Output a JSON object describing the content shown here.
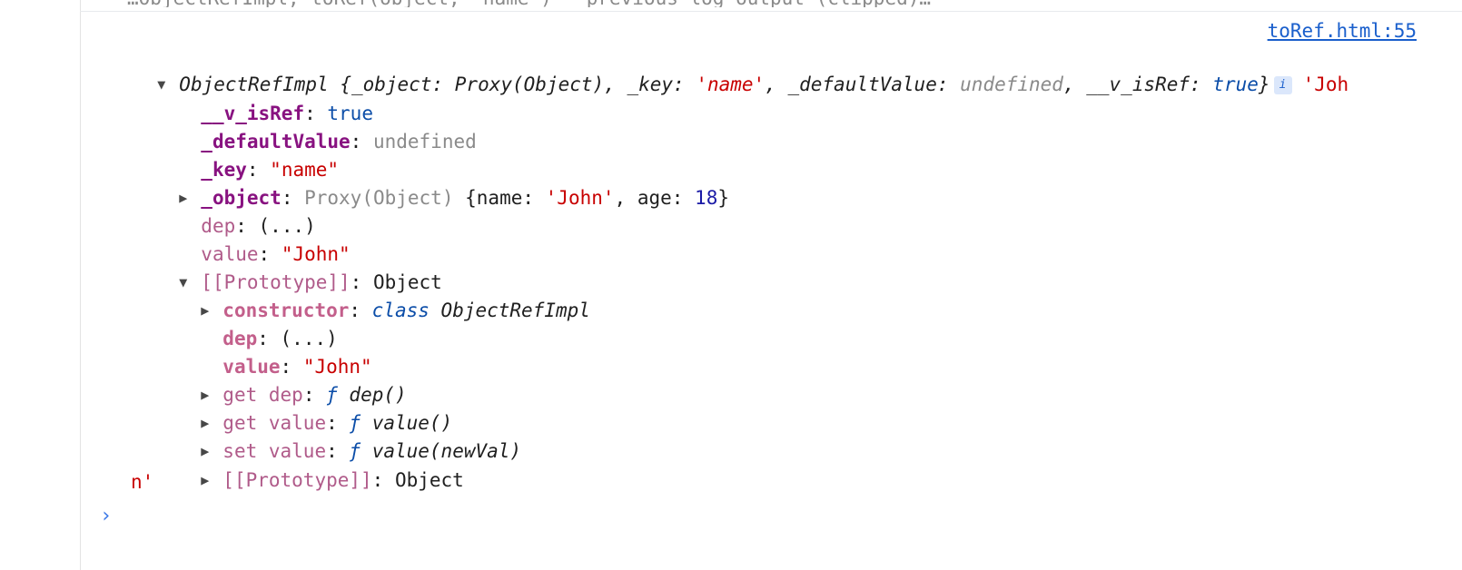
{
  "previous_line": "…ObjectRefImpl, toRef(object, 'name') — previous log output (clipped)…",
  "source_link": "toRef.html:55",
  "summary": {
    "class_name": "ObjectRefImpl",
    "open": " {",
    "p1_key": "_object",
    "p1_val": "Proxy(Object)",
    "p2_key": "_key",
    "p2_val": "'name'",
    "p3_key": "_defaultValue",
    "p3_val": "undefined",
    "p4_key": "__v_isRef",
    "p4_val": "true",
    "close": "}",
    "info_badge": "i",
    "trailing_value_start": "'Joh",
    "trailing_value_end": "n'"
  },
  "props": {
    "v_isref_key": "__v_isRef",
    "v_isref_val": "true",
    "default_key": "_defaultValue",
    "default_val": "undefined",
    "key_key": "_key",
    "key_val": "\"name\"",
    "object_key": "_object",
    "object_type": "Proxy(Object)",
    "object_preview_open": " {",
    "object_name_key": "name",
    "object_name_val": "'John'",
    "object_age_key": "age",
    "object_age_val": "18",
    "object_preview_close": "}",
    "dep_key": "dep",
    "dep_val": "(...)",
    "value_key": "value",
    "value_val": "\"John\""
  },
  "prototype": {
    "label": "[[Prototype]]",
    "type": "Object",
    "constructor_key": "constructor",
    "constructor_kw": "class",
    "constructor_name": "ObjectRefImpl",
    "dep_key": "dep",
    "dep_val": "(...)",
    "value_key": "value",
    "value_val": "\"John\"",
    "get_dep_key": "get dep",
    "get_dep_f": "ƒ",
    "get_dep_sig": "dep()",
    "get_value_key": "get value",
    "get_value_f": "ƒ",
    "get_value_sig": "value()",
    "set_value_key": "set value",
    "set_value_f": "ƒ",
    "set_value_sig": "value(newVal)",
    "inner_label": "[[Prototype]]",
    "inner_type": "Object"
  },
  "icons": {
    "expanded": "▼",
    "collapsed": "▶",
    "prompt": "›"
  }
}
